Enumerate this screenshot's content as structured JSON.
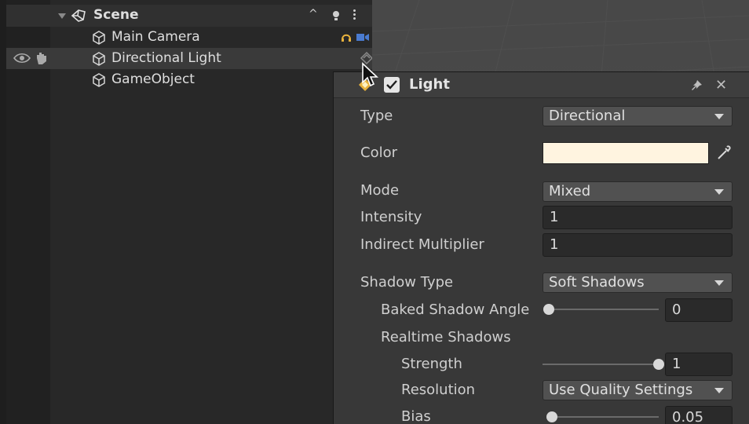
{
  "hierarchy": {
    "scene_name": "Scene",
    "items": [
      {
        "label": "Main Camera"
      },
      {
        "label": "Directional Light"
      },
      {
        "label": "GameObject"
      }
    ]
  },
  "inspector_popup": {
    "title": "Light",
    "enabled": true,
    "fields": {
      "type_label": "Type",
      "type_value": "Directional",
      "color_label": "Color",
      "color_value": "#fff4e0",
      "mode_label": "Mode",
      "mode_value": "Mixed",
      "intensity_label": "Intensity",
      "intensity_value": "1",
      "indirect_label": "Indirect Multiplier",
      "indirect_value": "1",
      "shadow_type_label": "Shadow Type",
      "shadow_type_value": "Soft Shadows",
      "baked_angle_label": "Baked Shadow Angle",
      "baked_angle_value": "0",
      "realtime_label": "Realtime Shadows",
      "strength_label": "Strength",
      "strength_value": "1",
      "resolution_label": "Resolution",
      "resolution_value": "Use Quality Settings",
      "bias_label": "Bias",
      "bias_value": "0.05"
    },
    "sliders": {
      "baked_angle_fraction": 0.0,
      "strength_fraction": 1.0,
      "bias_fraction": 0.025
    }
  },
  "colors": {
    "accent_yellow": "#e8b23c",
    "panel_bg": "#282828",
    "popup_bg": "#383838"
  }
}
